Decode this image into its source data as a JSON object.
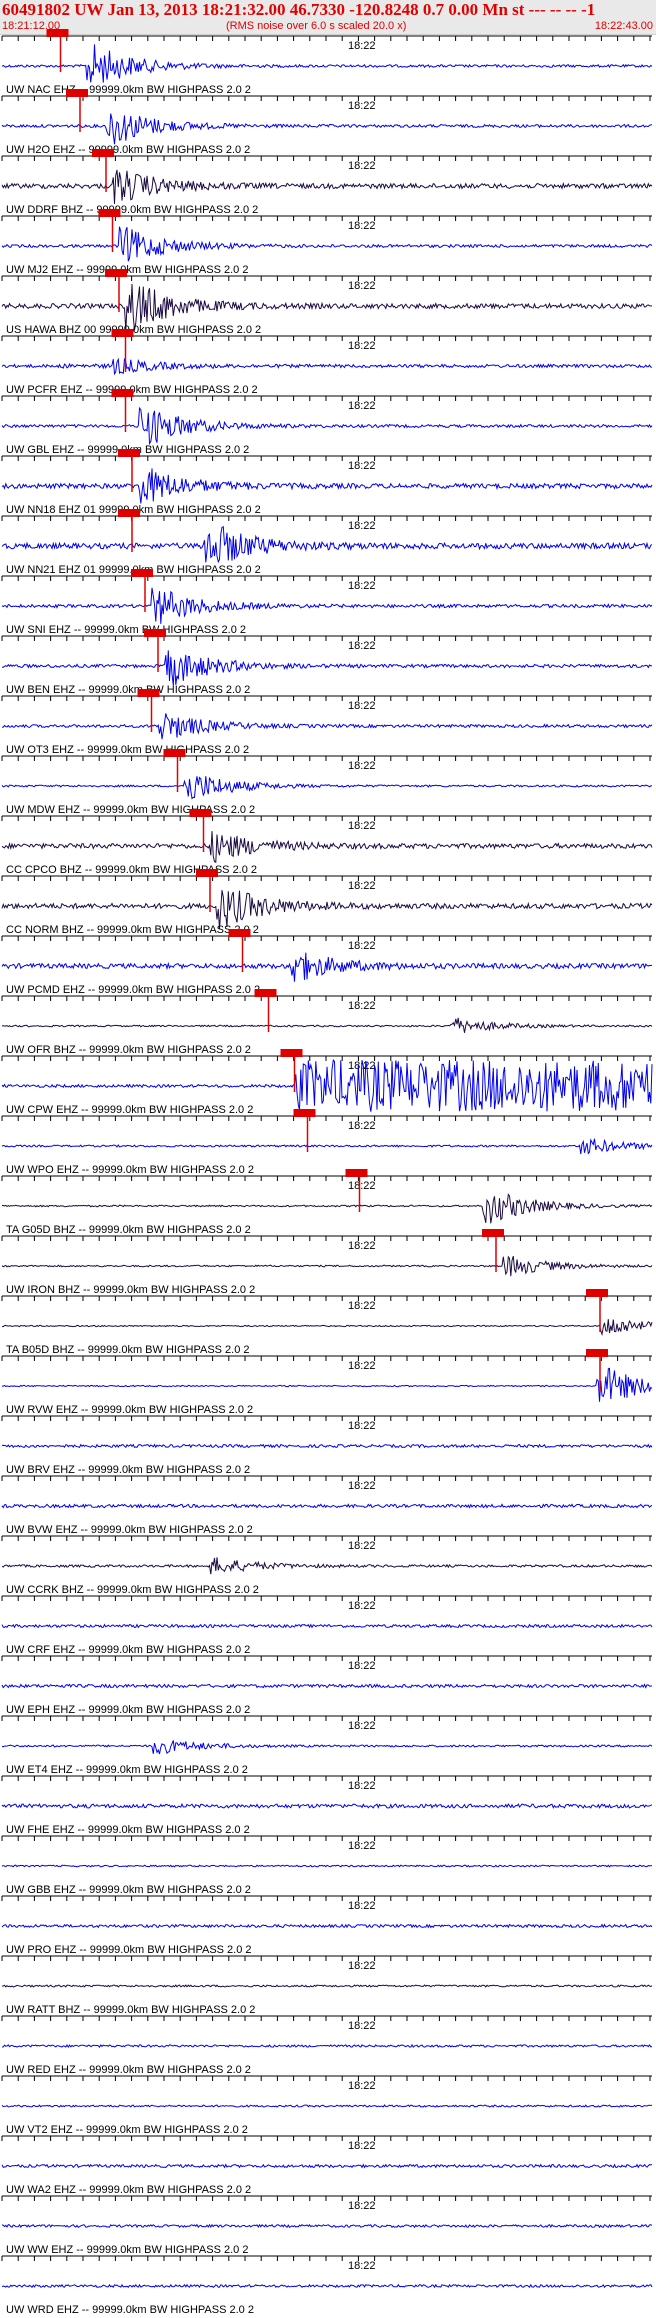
{
  "header": {
    "event_line": "60491802  UW Jan 13, 2013 18:21:32.00   46.7330  -120.8248  0.7 0.00 Mn st --- -- --   -1",
    "start_time": "18:21:12.00",
    "rms_note": "(RMS noise over 6.0 s scaled 20.0 x)",
    "end_time": "18:22:43.00"
  },
  "minute_label": "18:22",
  "colors": {
    "blue": "#0000ee",
    "purple": "#1c0a44",
    "pick": "#e00000",
    "axis": "#000000"
  },
  "traces": [
    {
      "label": "UW NAC EHZ -- 99999.0km BW  HIGHPASS  2.0  2",
      "color": "blue",
      "pick": 0.09,
      "burst": 0.14,
      "amp": 0.85,
      "noise": 0.16
    },
    {
      "label": "UW H2O EHZ -- 99999.0km BW  HIGHPASS  2.0  2",
      "color": "blue",
      "pick": 0.12,
      "burst": 0.17,
      "amp": 0.75,
      "noise": 0.18
    },
    {
      "label": "UW DDRF BHZ -- 99999.0km BW  HIGHPASS  2.0  2",
      "color": "purple",
      "pick": 0.16,
      "burst": 0.18,
      "amp": 0.65,
      "noise": 0.3
    },
    {
      "label": "UW MJ2 EHZ -- 99999.0km BW  HIGHPASS  2.0  2",
      "color": "blue",
      "pick": 0.17,
      "burst": 0.19,
      "amp": 0.7,
      "noise": 0.18
    },
    {
      "label": "US HAWA BHZ 00 99999.0km BW  HIGHPASS  2.0  2",
      "color": "purple",
      "pick": 0.18,
      "burst": 0.2,
      "amp": 1.0,
      "noise": 0.3
    },
    {
      "label": "UW PCFR EHZ -- 99999.0km BW  HIGHPASS  2.0  2",
      "color": "blue",
      "pick": 0.19,
      "burst": 0.1,
      "amp": 1.0,
      "noise": 0.2
    },
    {
      "label": "UW GBL EHZ -- 99999.0km BW  HIGHPASS  2.0  2",
      "color": "blue",
      "pick": 0.19,
      "burst": 0.22,
      "amp": 0.8,
      "noise": 0.18
    },
    {
      "label": "UW NN18 EHZ 01 99999.0km BW  HIGHPASS  2.0  2",
      "color": "blue",
      "pick": 0.2,
      "burst": 0.22,
      "amp": 0.7,
      "noise": 0.3
    },
    {
      "label": "UW NN21 EHZ 01 99999.0km BW  HIGHPASS  2.0  2",
      "color": "blue",
      "pick": 0.2,
      "burst": 0.32,
      "amp": 0.9,
      "noise": 0.35
    },
    {
      "label": "UW SNI EHZ -- 99999.0km BW  HIGHPASS  2.0  2",
      "color": "blue",
      "pick": 0.22,
      "burst": 0.24,
      "amp": 0.7,
      "noise": 0.2
    },
    {
      "label": "UW BEN EHZ -- 99999.0km BW  HIGHPASS  2.0  2",
      "color": "blue",
      "pick": 0.24,
      "burst": 0.26,
      "amp": 0.75,
      "noise": 0.2
    },
    {
      "label": "UW OT3 EHZ -- 99999.0km BW  HIGHPASS  2.0  2",
      "color": "blue",
      "pick": 0.23,
      "burst": 0.25,
      "amp": 0.55,
      "noise": 0.18
    },
    {
      "label": "UW MDW EHZ -- 99999.0km BW  HIGHPASS  2.0  2",
      "color": "blue",
      "pick": 0.27,
      "burst": 0.29,
      "amp": 0.6,
      "noise": 0.12
    },
    {
      "label": "CC CPCO BHZ -- 99999.0km BW  HIGHPASS  2.0  2",
      "color": "purple",
      "pick": 0.31,
      "burst": 0.33,
      "amp": 0.55,
      "noise": 0.3
    },
    {
      "label": "CC NORM BHZ -- 99999.0km BW  HIGHPASS  2.0  2",
      "color": "purple",
      "pick": 0.32,
      "burst": 0.34,
      "amp": 0.8,
      "noise": 0.32
    },
    {
      "label": "UW PCMD EHZ -- 99999.0km BW  HIGHPASS  2.0  2",
      "color": "blue",
      "pick": 0.37,
      "burst": 0.45,
      "amp": 0.6,
      "noise": 0.3
    },
    {
      "label": "UW OFR BHZ -- 99999.0km BW  HIGHPASS  2.0  2",
      "color": "purple",
      "pick": 0.41,
      "burst": 0.7,
      "amp": 0.3,
      "noise": 0.1
    },
    {
      "label": "UW CPW EHZ -- 99999.0km BW  HIGHPASS  2.0  2",
      "color": "blue",
      "pick": 0.45,
      "burst": 0.7,
      "amp": 1.0,
      "noise": 0.18
    },
    {
      "label": "UW WPO EHZ -- 99999.0km BW  HIGHPASS  2.0  2",
      "color": "blue",
      "pick": 0.47,
      "burst": 0.9,
      "amp": 0.3,
      "noise": 0.12
    },
    {
      "label": "TA G05D BHZ -- 99999.0km BW  HIGHPASS  2.0  2",
      "color": "purple",
      "pick": 0.55,
      "burst": 0.75,
      "amp": 0.7,
      "noise": 0.1
    },
    {
      "label": "UW IRON BHZ -- 99999.0km BW  HIGHPASS  2.0  2",
      "color": "purple",
      "pick": 0.76,
      "burst": 0.78,
      "amp": 0.4,
      "noise": 0.1
    },
    {
      "label": "TA B05D BHZ -- 99999.0km BW  HIGHPASS  2.0  2",
      "color": "purple",
      "pick": 0.92,
      "burst": 0.93,
      "amp": 0.4,
      "noise": 0.08
    },
    {
      "label": "UW RVW EHZ -- 99999.0km BW  HIGHPASS  2.0  2",
      "color": "blue",
      "pick": 0.92,
      "burst": 0.925,
      "amp": 0.8,
      "noise": 0.08
    },
    {
      "label": "UW BRV EHZ -- 99999.0km BW  HIGHPASS  2.0  2",
      "color": "blue",
      "noise": 0.18
    },
    {
      "label": "UW BVW EHZ -- 99999.0km BW  HIGHPASS  2.0  2",
      "color": "blue",
      "noise": 0.2
    },
    {
      "label": "UW CCRK BHZ -- 99999.0km BW  HIGHPASS  2.0  2",
      "color": "purple",
      "burst": 0.33,
      "amp": 0.3,
      "noise": 0.15
    },
    {
      "label": "UW CRF EHZ -- 99999.0km BW  HIGHPASS  2.0  2",
      "color": "blue",
      "noise": 0.18
    },
    {
      "label": "UW EPH EHZ -- 99999.0km BW  HIGHPASS  2.0  2",
      "color": "blue",
      "noise": 0.2
    },
    {
      "label": "UW ET4 EHZ -- 99999.0km BW  HIGHPASS  2.0  2",
      "color": "blue",
      "burst": 0.24,
      "amp": 0.3,
      "noise": 0.12
    },
    {
      "label": "UW FHE EHZ -- 99999.0km BW  HIGHPASS  2.0  2",
      "color": "blue",
      "noise": 0.24
    },
    {
      "label": "UW GBB EHZ -- 99999.0km BW  HIGHPASS  2.0  2",
      "color": "blue",
      "noise": 0.1
    },
    {
      "label": "UW PRO EHZ -- 99999.0km BW  HIGHPASS  2.0  2",
      "color": "blue",
      "noise": 0.18
    },
    {
      "label": "UW RATT BHZ -- 99999.0km BW  HIGHPASS  2.0  2",
      "color": "purple",
      "noise": 0.12
    },
    {
      "label": "UW RED EHZ -- 99999.0km BW  HIGHPASS  2.0  2",
      "color": "blue",
      "noise": 0.14
    },
    {
      "label": "UW VT2 EHZ -- 99999.0km BW  HIGHPASS  2.0  2",
      "color": "blue",
      "noise": 0.12
    },
    {
      "label": "UW WA2 EHZ -- 99999.0km BW  HIGHPASS  2.0  2",
      "color": "blue",
      "noise": 0.18
    },
    {
      "label": "UW WW EHZ -- 99999.0km BW  HIGHPASS  2.0  2",
      "color": "blue",
      "noise": 0.16
    },
    {
      "label": "UW WRD EHZ -- 99999.0km BW  HIGHPASS  2.0  2",
      "color": "blue",
      "noise": 0.16
    }
  ]
}
